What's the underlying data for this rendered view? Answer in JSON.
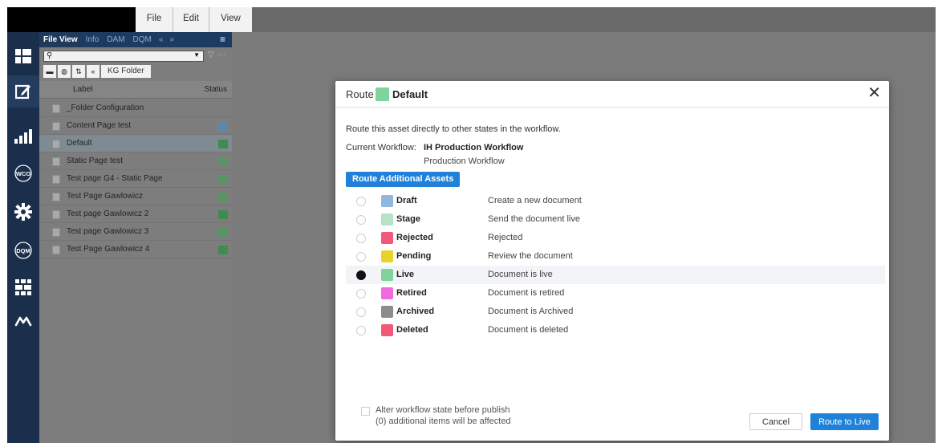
{
  "menubar": {
    "items": [
      {
        "label": "File"
      },
      {
        "label": "Edit"
      },
      {
        "label": "View"
      }
    ]
  },
  "rail": {
    "icons": [
      "layout-icon",
      "edit-icon",
      "analytics-icon",
      "wco-icon",
      "gear-icon",
      "dqm-icon",
      "grid-apps-icon",
      "infinity-icon"
    ],
    "wco_label": "WCO",
    "dqm_label": "DQM"
  },
  "panel": {
    "tabs": [
      {
        "label": "File View",
        "active": true
      },
      {
        "label": "Info"
      },
      {
        "label": "DAM"
      },
      {
        "label": "DQM"
      }
    ],
    "search": {
      "value": "",
      "placeholder": ""
    },
    "breadcrumb": "KG Folder",
    "columns": {
      "label": "Label",
      "status": "Status"
    },
    "rows": [
      {
        "name": "_Folder Configuration",
        "status_color": null
      },
      {
        "name": "Content Page test",
        "status_color": "#5f87a8"
      },
      {
        "name": "Default",
        "status_color": "#3f8c4f",
        "selected": true
      },
      {
        "name": "Static Page test",
        "status_color": "#5a9566"
      },
      {
        "name": "Test page G4 - Static Page",
        "status_color": "#5a9566"
      },
      {
        "name": "Test Page Gawlowicz",
        "status_color": "#5a9566"
      },
      {
        "name": "Test page Gawlowicz 2",
        "status_color": "#3f8c4f"
      },
      {
        "name": "Test page Gawlowicz 3",
        "status_color": "#5a9566"
      },
      {
        "name": "Test Page Gawlowicz 4",
        "status_color": "#3f8c4f"
      }
    ]
  },
  "modal": {
    "title_prefix": "Route",
    "title_state": "Default",
    "title_color": "#7ed49a",
    "description": "Route this asset directly to other states in the workflow.",
    "current_workflow_label": "Current Workflow:",
    "current_workflow_name": "IH Production Workflow",
    "current_workflow_sub": "Production Workflow",
    "route_additional_label": "Route Additional Assets",
    "states": [
      {
        "name": "Draft",
        "desc": "Create a new document",
        "color": "#8fb8dc"
      },
      {
        "name": "Stage",
        "desc": "Send the document live",
        "color": "#b5e3c4"
      },
      {
        "name": "Rejected",
        "desc": "Rejected",
        "color": "#f0597a"
      },
      {
        "name": "Pending",
        "desc": "Review the document",
        "color": "#e6d42a"
      },
      {
        "name": "Live",
        "desc": "Document is live",
        "color": "#7ed49a",
        "selected": true
      },
      {
        "name": "Retired",
        "desc": "Document is retired",
        "color": "#f06adf"
      },
      {
        "name": "Archived",
        "desc": "Document is Archived",
        "color": "#8c8c8c"
      },
      {
        "name": "Deleted",
        "desc": "Document is deleted",
        "color": "#f0597a"
      }
    ],
    "alter_label": "Alter workflow state before publish",
    "alter_note": "(0) additional items will be affected",
    "cancel_label": "Cancel",
    "route_label": "Route to Live"
  }
}
